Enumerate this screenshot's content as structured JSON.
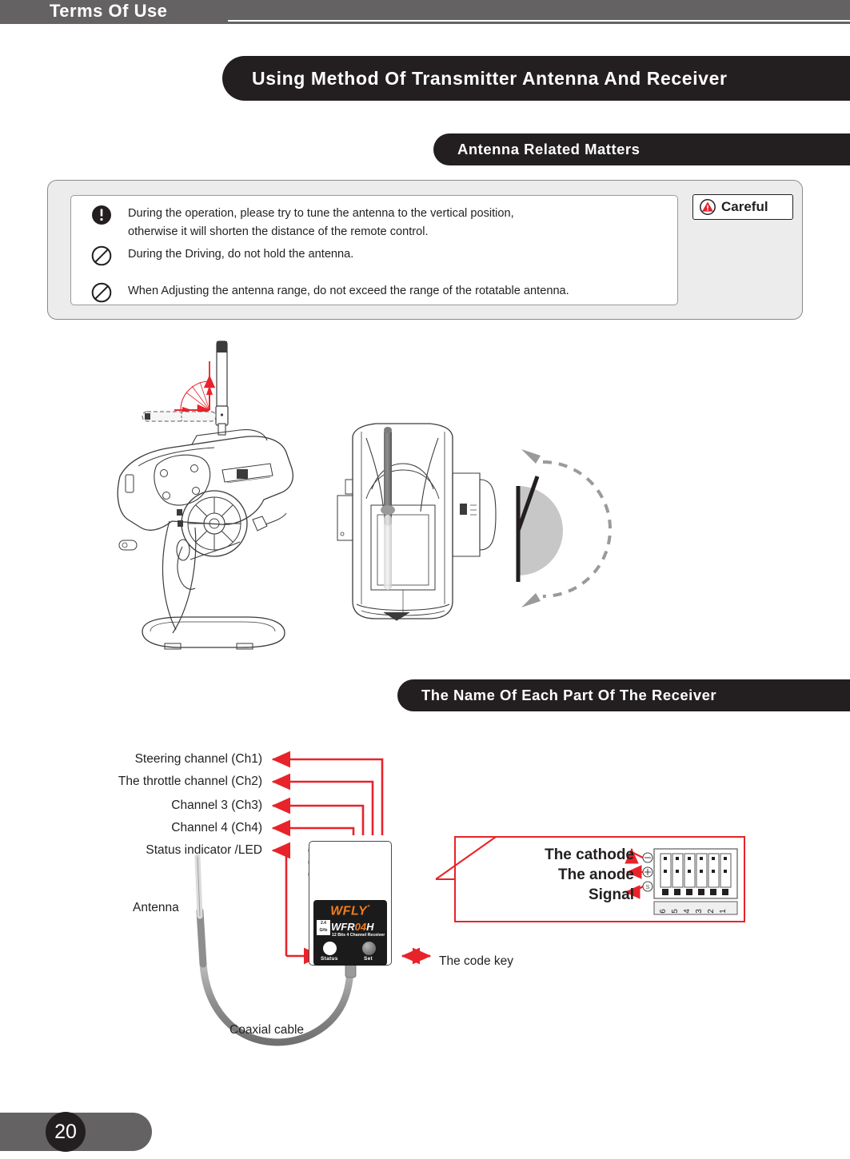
{
  "page": {
    "header_title": "Terms Of Use",
    "number": "20"
  },
  "sections": {
    "main_bar": "Using Method Of Transmitter Antenna And Receiver",
    "antenna_bar": "Antenna Related Matters",
    "receiver_bar": "The Name Of Each Part Of The Receiver"
  },
  "warning": {
    "badge_label": "Careful",
    "items": [
      {
        "icon": "exclamation-icon",
        "text": "During the operation, please try to tune the antenna to the vertical position,\notherwise it will shorten the distance of the remote control."
      },
      {
        "icon": "prohibition-icon",
        "text": "During the Driving, do not hold the antenna."
      },
      {
        "icon": "prohibition-icon",
        "text": "When Adjusting the antenna range, do not exceed the range of the rotatable antenna."
      }
    ]
  },
  "diagram": {
    "angle_side": "90°",
    "angle_top": "180°"
  },
  "receiver": {
    "labels": [
      "Steering channel (Ch1)",
      "The throttle channel (Ch2)",
      "Channel 3 (Ch3)",
      "Channel 4 (Ch4)",
      "Status indicator /LED"
    ],
    "antenna_label": "Antenna",
    "coaxial_label": "Coaxial cable",
    "code_key_label": "The code key",
    "brand": "WFLY",
    "brand_mark": "°",
    "model_prefix": "WFR",
    "model_highlight": "04",
    "model_suffix": "H",
    "model_sub": "12 Bits 4 Channel Receiver",
    "band_top": "2.4",
    "band_bottom": "GHz",
    "button_status": "Status",
    "button_set": "Set",
    "pin_numbers": [
      "6",
      "5",
      "4",
      "3",
      "2",
      "1"
    ],
    "row_markers": [
      "⊖",
      "⊕",
      "Ⓢ"
    ]
  },
  "callout": {
    "cathode": "The cathode",
    "anode": "The anode",
    "signal": "Signal"
  },
  "colors": {
    "header_gray": "#656263",
    "bar_black": "#231f20",
    "accent_red": "#e8232a",
    "brand_orange": "#f07c20",
    "panel_gray": "#ececec"
  }
}
